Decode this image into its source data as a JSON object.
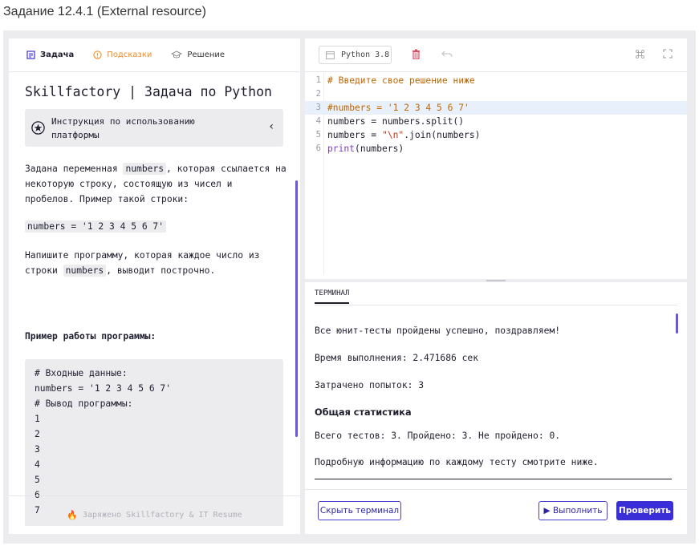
{
  "page": {
    "title": "Задание 12.4.1 (External resource)"
  },
  "left_panel": {
    "tabs": [
      {
        "label": "Задача",
        "icon": "document-icon"
      },
      {
        "label": "Подсказки",
        "icon": "info-icon"
      },
      {
        "label": "Решение",
        "icon": "graduation-cap-icon"
      }
    ],
    "task_title": "Skillfactory | Задача по Python",
    "instructions_line1": "Инструкция по использованию",
    "instructions_line2": "платформы",
    "description_line1_a": "Задана переменная ",
    "description_code1": "numbers",
    "description_line1_b": ", которая ссылается на",
    "description_line2": "некоторую строку, состоящую из чисел и",
    "description_line3": "пробелов. Пример такой строки:",
    "example_string": "numbers = '1 2 3 4 5 6 7'",
    "task_line1": "Напишите программу, которая каждое число из",
    "task_line2_a": "строки ",
    "task_code": "numbers",
    "task_line2_b": ", выводит построчно.",
    "example_heading": "Пример работы программы:",
    "code_block": [
      "# Входные данные:",
      "numbers = '1 2 3 4 5 6 7'",
      "# Вывод программы:",
      "1",
      "2",
      "3",
      "4",
      "5",
      "6",
      "7"
    ],
    "footer": "Заряжено Skillfactory & IT Resume"
  },
  "editor": {
    "language": "Python 3.8",
    "lines": [
      {
        "n": "1",
        "text": "# Введите свое решение ниже"
      },
      {
        "n": "2",
        "text": ""
      },
      {
        "n": "3",
        "text": "#numbers = '1 2 3 4 5 6 7'"
      },
      {
        "n": "4",
        "text": "numbers = numbers.split()"
      },
      {
        "n": "5",
        "text": "numbers = \"\\n\".join(numbers)"
      },
      {
        "n": "6",
        "text": "print(numbers)"
      }
    ],
    "line5_a": "numbers = ",
    "line5_str": "\"\\n\"",
    "line5_b": ".join(numbers)",
    "line6_kw": "print",
    "line6_rest": "(numbers)"
  },
  "terminal": {
    "tab_label": "ТЕРМИНАЛ",
    "success": "Все юнит-тесты пройдены успешно, поздравляем!",
    "exec_time": "Время выполнения: 2.471686 сек",
    "attempts": "Затрачено попыток: 3",
    "stats_heading": "Общая статистика",
    "stats": "Всего тестов: 3. Пройдено: 3. Не пройдено: 0.",
    "details": "Подробную информацию по каждому тесту смотрите ниже."
  },
  "footer_buttons": {
    "hide_terminal": "Скрыть терминал",
    "run": "▶ Выполнить",
    "check": "Проверить"
  },
  "colors": {
    "accent": "#3a2fd6",
    "hint_orange": "#f08a24",
    "comment": "#c06600",
    "string": "#c0381a"
  }
}
